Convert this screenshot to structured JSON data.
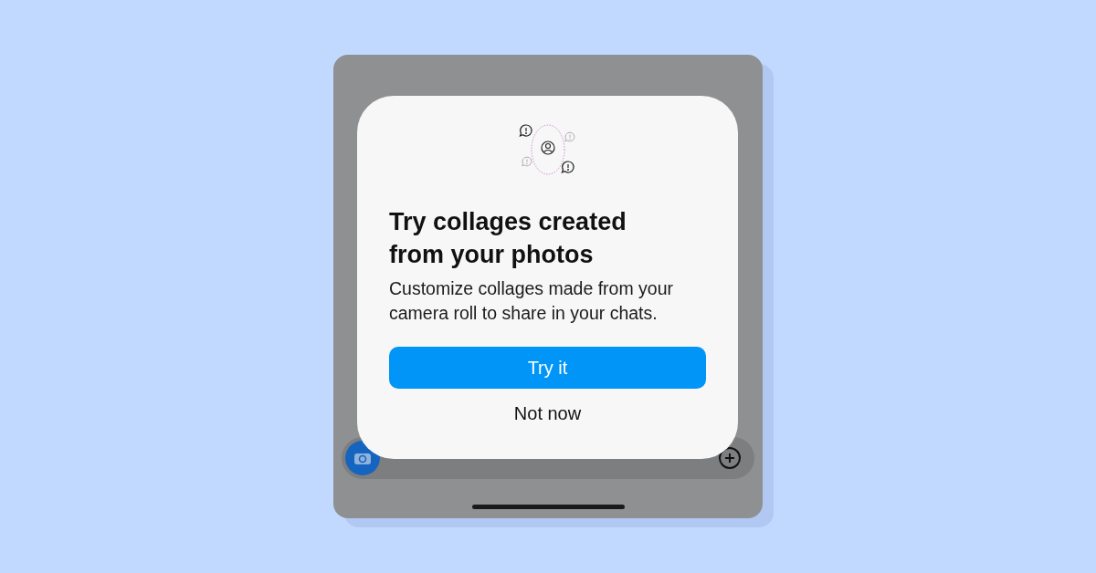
{
  "dialog": {
    "title": "Try collages created from your photos",
    "body": "Customize collages made from your camera roll to share in your chats.",
    "buttons": [
      {
        "label": "Try it",
        "kind": "primary"
      },
      {
        "label": "Not now",
        "kind": "secondary"
      }
    ]
  }
}
